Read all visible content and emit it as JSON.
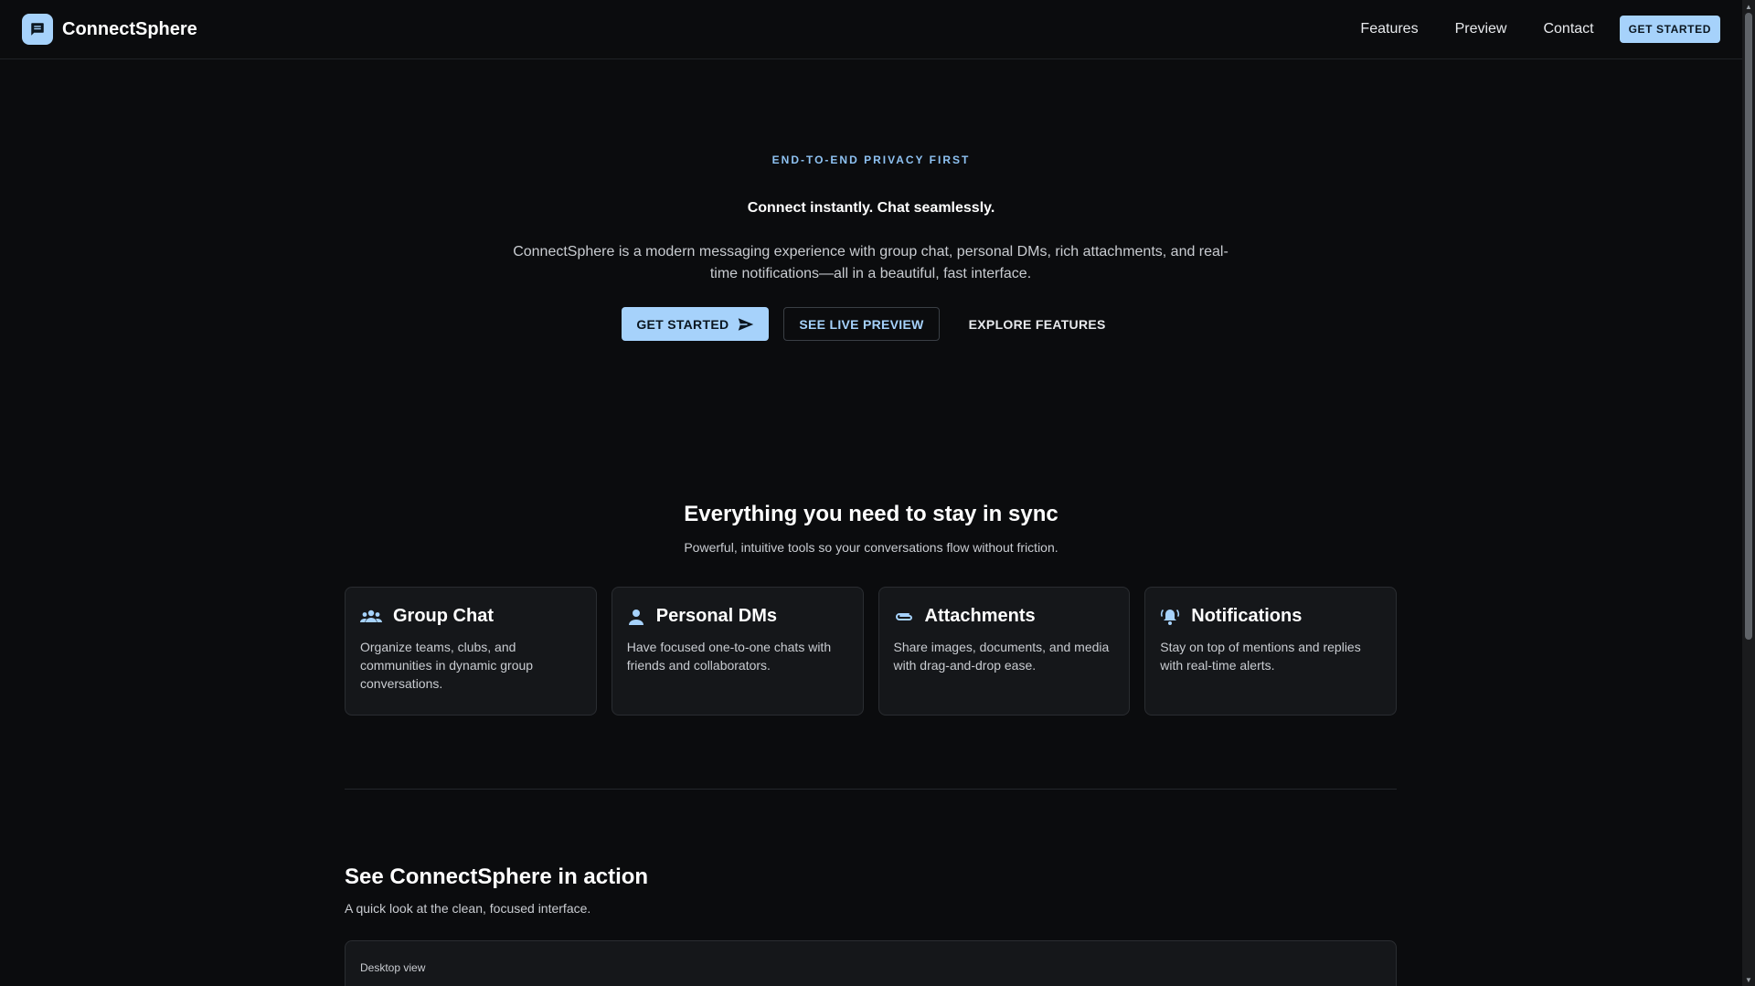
{
  "brand": {
    "name": "ConnectSphere",
    "logo_icon": "chat-bubble-icon"
  },
  "nav": {
    "items": [
      "Features",
      "Preview",
      "Contact"
    ],
    "cta_label": "GET STARTED"
  },
  "hero": {
    "eyebrow": "END-TO-END PRIVACY FIRST",
    "title": "Connect instantly. Chat seamlessly.",
    "description": "ConnectSphere is a modern messaging experience with group chat, personal DMs, rich attachments, and real-time notifications—all in a beautiful, fast interface.",
    "primary_label": "GET STARTED",
    "outline_label": "SEE LIVE PREVIEW",
    "text_label": "EXPLORE FEATURES"
  },
  "features": {
    "title": "Everything you need to stay in sync",
    "subtitle": "Powerful, intuitive tools so your conversations flow without friction.",
    "cards": [
      {
        "icon": "group-icon",
        "title": "Group Chat",
        "desc": "Organize teams, clubs, and communities in dynamic group conversations."
      },
      {
        "icon": "person-icon",
        "title": "Personal DMs",
        "desc": "Have focused one-to-one chats with friends and collaborators."
      },
      {
        "icon": "attachment-icon",
        "title": "Attachments",
        "desc": "Share images, documents, and media with drag-and-drop ease."
      },
      {
        "icon": "bell-icon",
        "title": "Notifications",
        "desc": "Stay on top of mentions and replies with real-time alerts."
      }
    ]
  },
  "action": {
    "title": "See ConnectSphere in action",
    "subtitle": "A quick look at the clean, focused interface.",
    "panel_label": "Desktop view"
  },
  "colors": {
    "accent": "#a6d2fb",
    "background": "#0b0c0e",
    "card": "#15171a"
  }
}
